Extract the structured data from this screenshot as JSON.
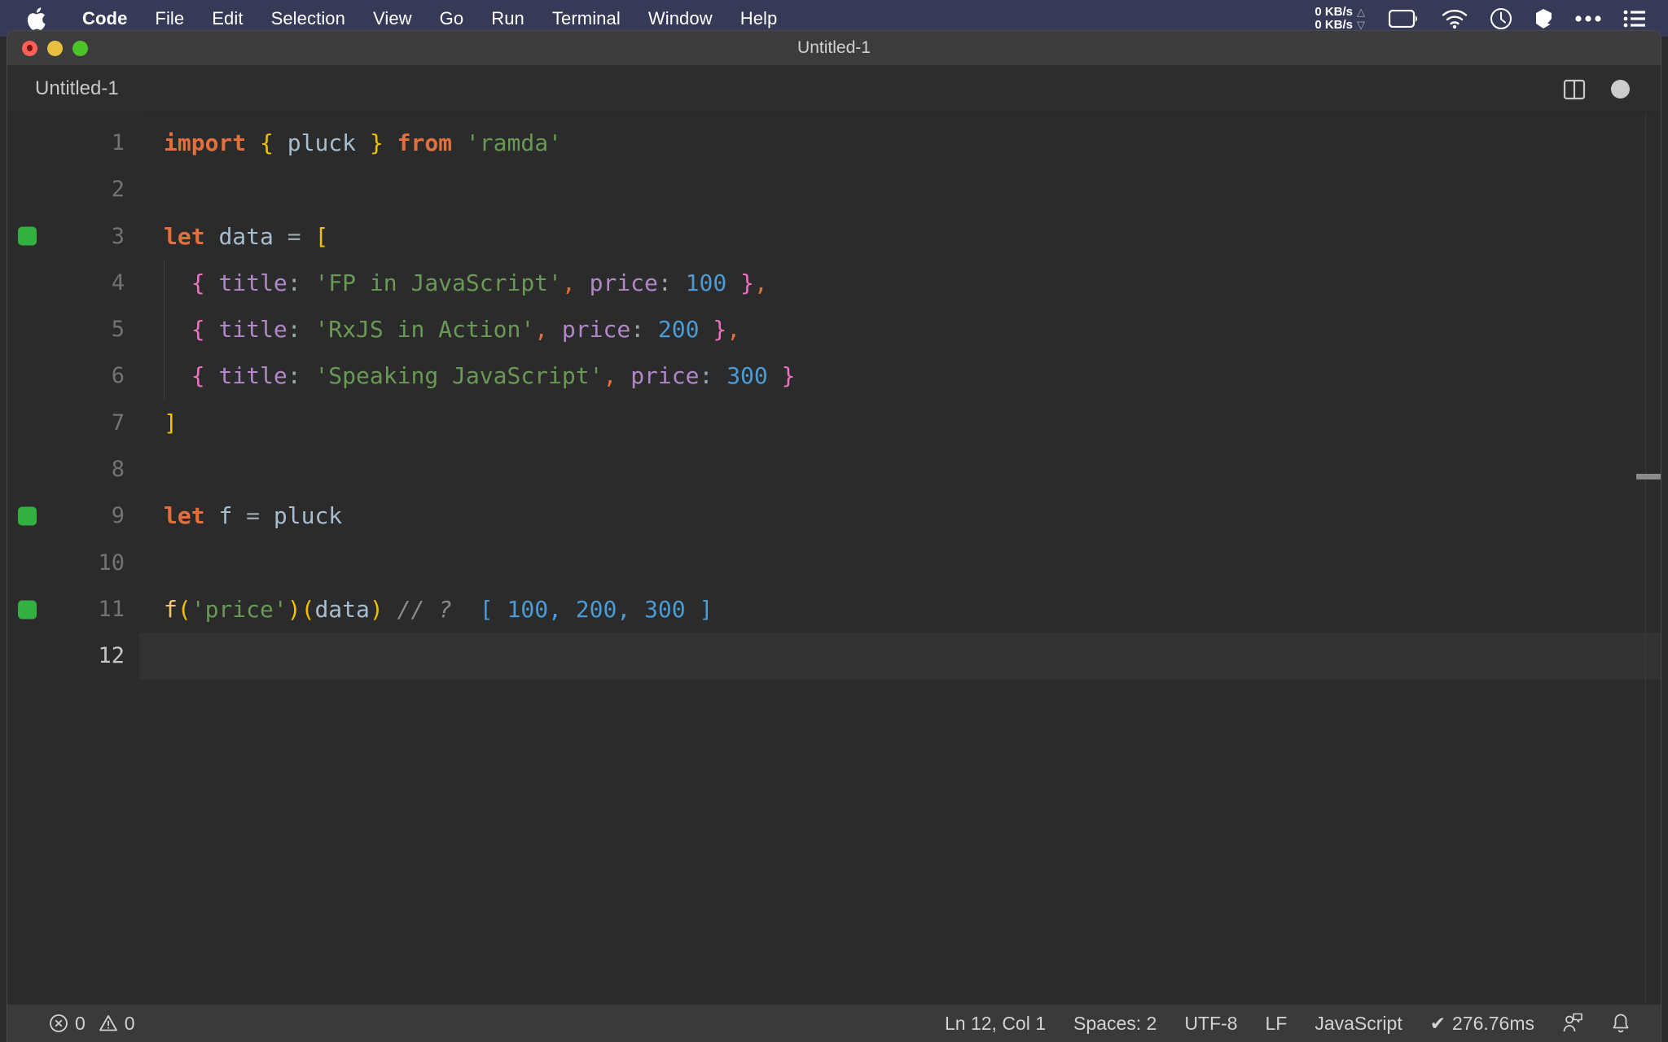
{
  "menubar": {
    "apple_icon": "apple-logo-icon",
    "items": [
      {
        "label": "Code",
        "bold": true
      },
      {
        "label": "File",
        "bold": false
      },
      {
        "label": "Edit",
        "bold": false
      },
      {
        "label": "Selection",
        "bold": false
      },
      {
        "label": "View",
        "bold": false
      },
      {
        "label": "Go",
        "bold": false
      },
      {
        "label": "Run",
        "bold": false
      },
      {
        "label": "Terminal",
        "bold": false
      },
      {
        "label": "Window",
        "bold": false
      },
      {
        "label": "Help",
        "bold": false
      }
    ],
    "tray": {
      "network_up": "0 KB/s",
      "network_down": "0 KB/s",
      "up_arrow": "△",
      "down_arrow": "▽",
      "icons": [
        "battery-icon",
        "wifi-icon",
        "clock-icon",
        "dropbox-icon",
        "ellipsis-icon",
        "control-center-icon"
      ]
    },
    "background": "#363a56"
  },
  "window": {
    "title": "Untitled-1",
    "traffic_lights": [
      "close-button",
      "minimize-button",
      "maximize-button"
    ]
  },
  "tabbar": {
    "tab_label": "Untitled-1",
    "split_icon": "split-editor-icon",
    "dirty_indicator": "unsaved-dot-indicator"
  },
  "editor": {
    "active_line": 12,
    "lines": [
      {
        "number": "1",
        "marker": false,
        "indent_guide": false,
        "tokens": [
          {
            "t": "import",
            "c": "t-kw"
          },
          {
            "t": " ",
            "c": "t-punct"
          },
          {
            "t": "{",
            "c": "t-brace"
          },
          {
            "t": " ",
            "c": "t-punct"
          },
          {
            "t": "pluck",
            "c": "t-ident"
          },
          {
            "t": " ",
            "c": "t-punct"
          },
          {
            "t": "}",
            "c": "t-brace"
          },
          {
            "t": " ",
            "c": "t-punct"
          },
          {
            "t": "from",
            "c": "t-kw"
          },
          {
            "t": " ",
            "c": "t-punct"
          },
          {
            "t": "'ramda'",
            "c": "t-str"
          }
        ]
      },
      {
        "number": "2",
        "marker": false,
        "indent_guide": false,
        "tokens": []
      },
      {
        "number": "3",
        "marker": true,
        "indent_guide": false,
        "tokens": [
          {
            "t": "let",
            "c": "t-kw"
          },
          {
            "t": " ",
            "c": "t-punct"
          },
          {
            "t": "data",
            "c": "t-ident"
          },
          {
            "t": " ",
            "c": "t-punct"
          },
          {
            "t": "=",
            "c": "t-punct"
          },
          {
            "t": " ",
            "c": "t-punct"
          },
          {
            "t": "[",
            "c": "t-brace"
          }
        ]
      },
      {
        "number": "4",
        "marker": false,
        "indent_guide": true,
        "tokens": [
          {
            "t": "  ",
            "c": "t-punct"
          },
          {
            "t": "{",
            "c": "t-objbrace"
          },
          {
            "t": " ",
            "c": "t-punct"
          },
          {
            "t": "title",
            "c": "t-key"
          },
          {
            "t": ":",
            "c": "t-colon"
          },
          {
            "t": " ",
            "c": "t-punct"
          },
          {
            "t": "'FP in JavaScript'",
            "c": "t-str"
          },
          {
            "t": ",",
            "c": "t-comma"
          },
          {
            "t": " ",
            "c": "t-punct"
          },
          {
            "t": "price",
            "c": "t-key"
          },
          {
            "t": ":",
            "c": "t-colon"
          },
          {
            "t": " ",
            "c": "t-punct"
          },
          {
            "t": "100",
            "c": "t-num"
          },
          {
            "t": " ",
            "c": "t-punct"
          },
          {
            "t": "}",
            "c": "t-objbrace"
          },
          {
            "t": ",",
            "c": "t-comma"
          }
        ]
      },
      {
        "number": "5",
        "marker": false,
        "indent_guide": true,
        "tokens": [
          {
            "t": "  ",
            "c": "t-punct"
          },
          {
            "t": "{",
            "c": "t-objbrace"
          },
          {
            "t": " ",
            "c": "t-punct"
          },
          {
            "t": "title",
            "c": "t-key"
          },
          {
            "t": ":",
            "c": "t-colon"
          },
          {
            "t": " ",
            "c": "t-punct"
          },
          {
            "t": "'RxJS in Action'",
            "c": "t-str"
          },
          {
            "t": ",",
            "c": "t-comma"
          },
          {
            "t": " ",
            "c": "t-punct"
          },
          {
            "t": "price",
            "c": "t-key"
          },
          {
            "t": ":",
            "c": "t-colon"
          },
          {
            "t": " ",
            "c": "t-punct"
          },
          {
            "t": "200",
            "c": "t-num"
          },
          {
            "t": " ",
            "c": "t-punct"
          },
          {
            "t": "}",
            "c": "t-objbrace"
          },
          {
            "t": ",",
            "c": "t-comma"
          }
        ]
      },
      {
        "number": "6",
        "marker": false,
        "indent_guide": true,
        "tokens": [
          {
            "t": "  ",
            "c": "t-punct"
          },
          {
            "t": "{",
            "c": "t-objbrace"
          },
          {
            "t": " ",
            "c": "t-punct"
          },
          {
            "t": "title",
            "c": "t-key"
          },
          {
            "t": ":",
            "c": "t-colon"
          },
          {
            "t": " ",
            "c": "t-punct"
          },
          {
            "t": "'Speaking JavaScript'",
            "c": "t-str"
          },
          {
            "t": ",",
            "c": "t-comma"
          },
          {
            "t": " ",
            "c": "t-punct"
          },
          {
            "t": "price",
            "c": "t-key"
          },
          {
            "t": ":",
            "c": "t-colon"
          },
          {
            "t": " ",
            "c": "t-punct"
          },
          {
            "t": "300",
            "c": "t-num"
          },
          {
            "t": " ",
            "c": "t-punct"
          },
          {
            "t": "}",
            "c": "t-objbrace"
          }
        ]
      },
      {
        "number": "7",
        "marker": false,
        "indent_guide": false,
        "tokens": [
          {
            "t": "]",
            "c": "t-brace"
          }
        ]
      },
      {
        "number": "8",
        "marker": false,
        "indent_guide": false,
        "tokens": []
      },
      {
        "number": "9",
        "marker": true,
        "indent_guide": false,
        "tokens": [
          {
            "t": "let",
            "c": "t-kw"
          },
          {
            "t": " ",
            "c": "t-punct"
          },
          {
            "t": "f",
            "c": "t-ident"
          },
          {
            "t": " ",
            "c": "t-punct"
          },
          {
            "t": "=",
            "c": "t-punct"
          },
          {
            "t": " ",
            "c": "t-punct"
          },
          {
            "t": "pluck",
            "c": "t-ident"
          }
        ]
      },
      {
        "number": "10",
        "marker": false,
        "indent_guide": false,
        "tokens": []
      },
      {
        "number": "11",
        "marker": true,
        "indent_guide": false,
        "tokens": [
          {
            "t": "f",
            "c": "t-fn"
          },
          {
            "t": "(",
            "c": "t-paren"
          },
          {
            "t": "'price'",
            "c": "t-str"
          },
          {
            "t": ")",
            "c": "t-paren"
          },
          {
            "t": "(",
            "c": "t-paren"
          },
          {
            "t": "data",
            "c": "t-ident"
          },
          {
            "t": ")",
            "c": "t-paren"
          },
          {
            "t": " ",
            "c": "t-punct"
          },
          {
            "t": "// ?",
            "c": "t-comment"
          },
          {
            "t": "  ",
            "c": "t-punct"
          },
          {
            "t": "[ 100, 200, 300 ]",
            "c": "t-result"
          }
        ]
      },
      {
        "number": "12",
        "marker": false,
        "indent_guide": false,
        "tokens": []
      }
    ]
  },
  "statusbar": {
    "error_icon": "error-circle-icon",
    "error_count": "0",
    "warning_icon": "warning-triangle-icon",
    "warning_count": "0",
    "cursor_position": "Ln 12, Col 1",
    "indentation": "Spaces: 2",
    "encoding": "UTF-8",
    "eol": "LF",
    "language": "JavaScript",
    "quokka_check": "✔",
    "quokka_time": "276.76ms",
    "feedback_icon": "feedback-person-icon",
    "bell_icon": "notifications-bell-icon"
  },
  "colors": {
    "menubar_bg": "#363a56",
    "titlebar_bg": "#3c3c3c",
    "tabbar_bg": "#2d2d2d",
    "editor_bg": "#2b2b2b",
    "statusbar_bg": "#3a3a3a",
    "gutter_marker": "#33b140"
  }
}
